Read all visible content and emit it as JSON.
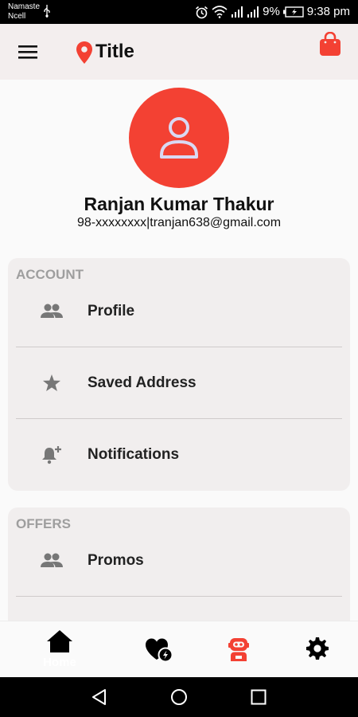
{
  "status_bar": {
    "carrier_line1": "Namaste",
    "carrier_line2": "Ncell",
    "battery": "9%",
    "time": "9:38 pm"
  },
  "app_bar": {
    "title": "Title",
    "icons": [
      "menu-icon",
      "location-pin-icon",
      "shopping-bag-icon"
    ],
    "accent_color": "#f34133"
  },
  "profile": {
    "name": "Ranjan Kumar Thakur",
    "contact": "98-xxxxxxxx|tranjan638@gmail.com",
    "avatar_icon": "person-icon"
  },
  "sections": {
    "account": {
      "label": "ACCOUNT",
      "items": [
        {
          "label": "Profile",
          "icon": "people-icon"
        },
        {
          "label": "Saved Address",
          "icon": "star-icon"
        },
        {
          "label": "Notifications",
          "icon": "bell-plus-icon"
        }
      ]
    },
    "offers": {
      "label": "OFFERS",
      "items": [
        {
          "label": "Promos",
          "icon": "people-icon"
        }
      ]
    }
  },
  "bottom_nav": {
    "items": [
      {
        "label": "Home",
        "icon": "home-icon"
      },
      {
        "label": "",
        "icon": "heart-flash-icon"
      },
      {
        "label": "",
        "icon": "robot-icon",
        "active": true
      },
      {
        "label": "",
        "icon": "gear-icon"
      }
    ]
  },
  "system_nav": [
    "back-icon",
    "home-circle-icon",
    "recents-icon"
  ]
}
